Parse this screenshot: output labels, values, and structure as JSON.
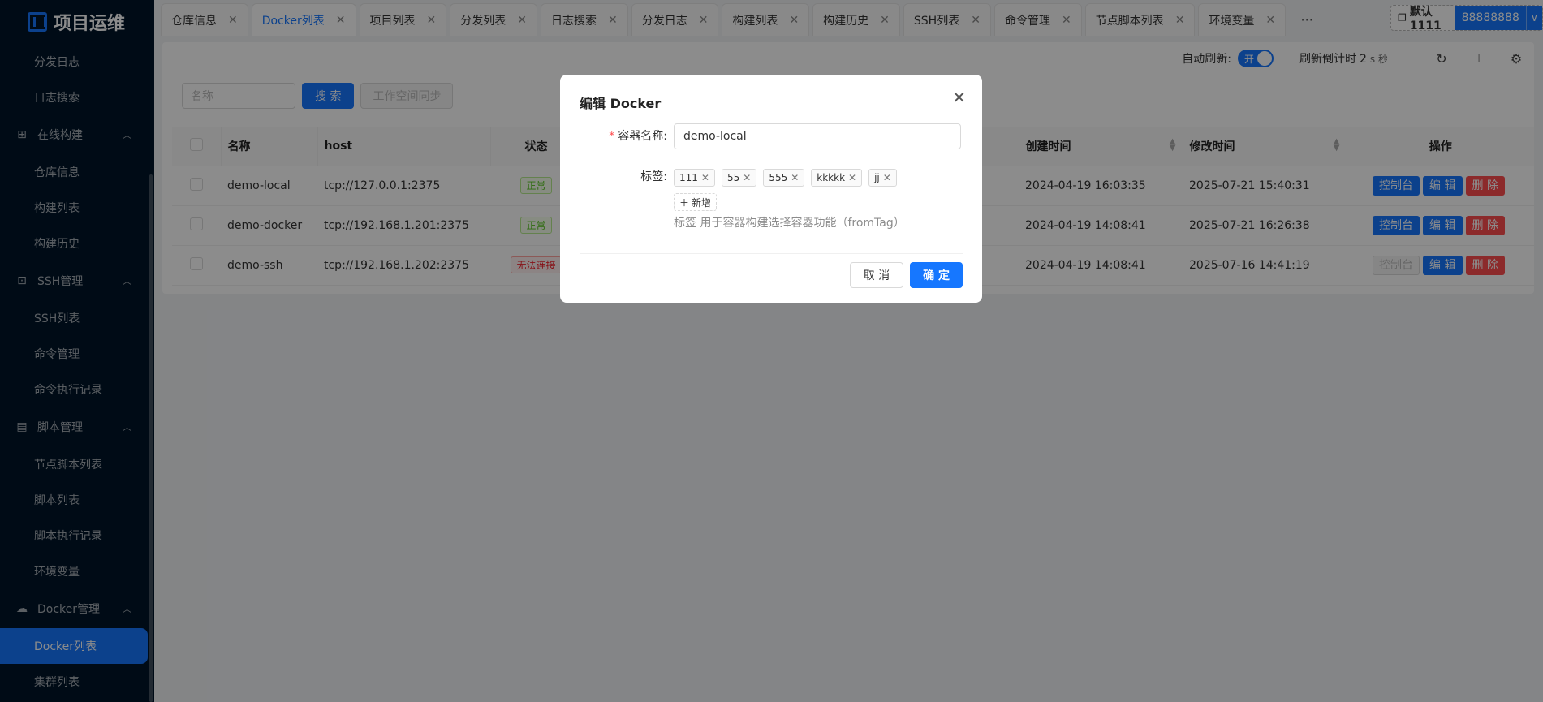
{
  "sidebar": {
    "logo": "项目运维",
    "items": [
      {
        "kind": "sub",
        "label": "分发日志"
      },
      {
        "kind": "sub",
        "label": "日志搜索"
      },
      {
        "kind": "group",
        "label": "在线构建",
        "icon": "build-icon"
      },
      {
        "kind": "sub",
        "label": "仓库信息"
      },
      {
        "kind": "sub",
        "label": "构建列表"
      },
      {
        "kind": "sub",
        "label": "构建历史"
      },
      {
        "kind": "group",
        "label": "SSH管理",
        "icon": "terminal-icon"
      },
      {
        "kind": "sub",
        "label": "SSH列表"
      },
      {
        "kind": "sub",
        "label": "命令管理"
      },
      {
        "kind": "sub",
        "label": "命令执行记录"
      },
      {
        "kind": "group",
        "label": "脚本管理",
        "icon": "file-icon"
      },
      {
        "kind": "sub",
        "label": "节点脚本列表"
      },
      {
        "kind": "sub",
        "label": "脚本列表"
      },
      {
        "kind": "sub",
        "label": "脚本执行记录"
      },
      {
        "kind": "sub",
        "label": "环境变量"
      },
      {
        "kind": "group",
        "label": "Docker管理",
        "icon": "cloud-icon"
      },
      {
        "kind": "sub",
        "label": "Docker列表",
        "active": true
      },
      {
        "kind": "sub",
        "label": "集群列表"
      }
    ]
  },
  "tabs": [
    {
      "label": "仓库信息"
    },
    {
      "label": "Docker列表",
      "active": true
    },
    {
      "label": "项目列表"
    },
    {
      "label": "分发列表"
    },
    {
      "label": "日志搜索"
    },
    {
      "label": "分发日志"
    },
    {
      "label": "构建列表"
    },
    {
      "label": "构建历史"
    },
    {
      "label": "SSH列表"
    },
    {
      "label": "命令管理"
    },
    {
      "label": "节点脚本列表"
    },
    {
      "label": "环境变量"
    }
  ],
  "workspace": {
    "name": "默认1111",
    "user": "88888888"
  },
  "toolbar": {
    "auto_refresh_label": "自动刷新:",
    "switch_text": "开",
    "countdown_label": "刷新倒计时",
    "countdown_value": "2",
    "countdown_unit": "s 秒"
  },
  "search": {
    "placeholder": "名称",
    "search_label": "搜 索",
    "sync_label": "工作空间同步"
  },
  "table": {
    "headers": {
      "name": "名称",
      "host": "host",
      "status": "状态",
      "created": "创建时间",
      "modified": "修改时间",
      "ops": "操作"
    },
    "rows": [
      {
        "name": "demo-local",
        "host": "tcp://127.0.0.1:2375",
        "status": "正常",
        "status_ok": true,
        "created": "2024-04-19 16:03:35",
        "modified": "2025-07-21 15:40:31",
        "console_enabled": true
      },
      {
        "name": "demo-docker",
        "host": "tcp://192.168.1.201:2375",
        "status": "正常",
        "status_ok": true,
        "created": "2024-04-19 14:08:41",
        "modified": "2025-07-21 16:26:38",
        "console_enabled": true
      },
      {
        "name": "demo-ssh",
        "host": "tcp://192.168.1.202:2375",
        "status": "无法连接",
        "status_ok": false,
        "created": "2024-04-19 14:08:41",
        "modified": "2025-07-16 14:41:19",
        "console_enabled": false
      }
    ],
    "op_labels": {
      "console": "控制台",
      "edit": "编 辑",
      "delete": "删 除"
    }
  },
  "modal": {
    "title": "编辑 Docker",
    "name_label": "容器名称:",
    "name_value": "demo-local",
    "tags_label": "标签:",
    "tags": [
      "111",
      "55",
      "555",
      "kkkkk",
      "jj"
    ],
    "add_tag_label": "新增",
    "help": "标签 用于容器构建选择容器功能（fromTag）",
    "cancel_label": "取 消",
    "ok_label": "确 定"
  }
}
